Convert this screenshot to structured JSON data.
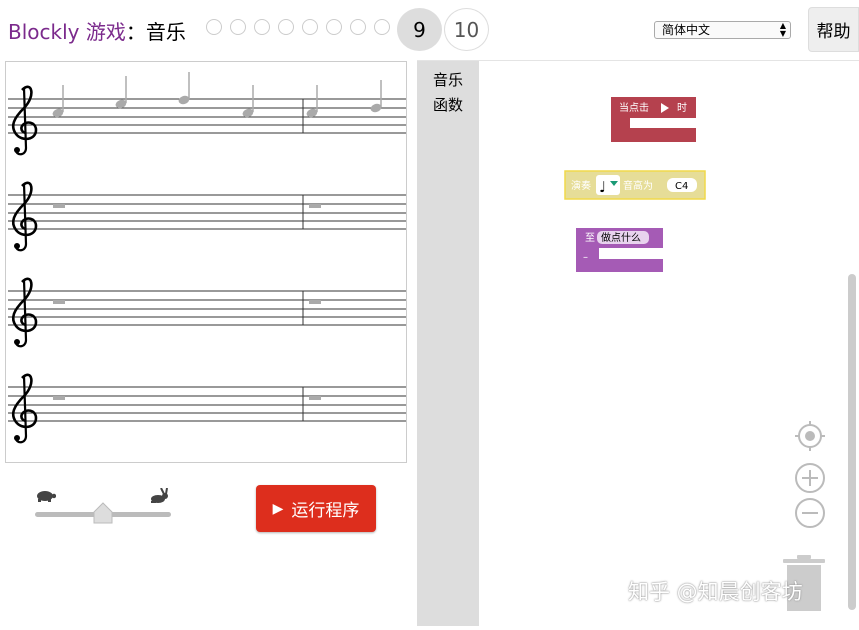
{
  "header": {
    "brand": "Blockly 游戏",
    "separator": "：",
    "game": "音乐",
    "levels_done": [
      "1",
      "2",
      "3",
      "4",
      "5",
      "6",
      "7",
      "8"
    ],
    "current_level": "9",
    "next_level": "10",
    "language": "简体中文",
    "help_label": "帮助"
  },
  "score": {
    "staff_count": 4
  },
  "controls": {
    "speed_value": 0.5,
    "run_label": "运行程序",
    "slow_icon": "turtle-icon",
    "fast_icon": "rabbit-icon"
  },
  "toolbox": {
    "categories": [
      "音乐",
      "函数"
    ]
  },
  "blocks": {
    "event": {
      "label": "当点击",
      "suffix": "时",
      "color": "#b5414e"
    },
    "play": {
      "label": "演奏",
      "pitch_label": "音高为",
      "pitch": "C4",
      "color": "#e6dd98"
    },
    "func": {
      "label": "至",
      "name": "做点什么",
      "color": "#a55bb5"
    }
  },
  "workspace_icons": [
    "target-icon",
    "zoom-in-icon",
    "zoom-out-icon",
    "trash-icon"
  ],
  "watermark": "知乎 @知晨创客坊"
}
